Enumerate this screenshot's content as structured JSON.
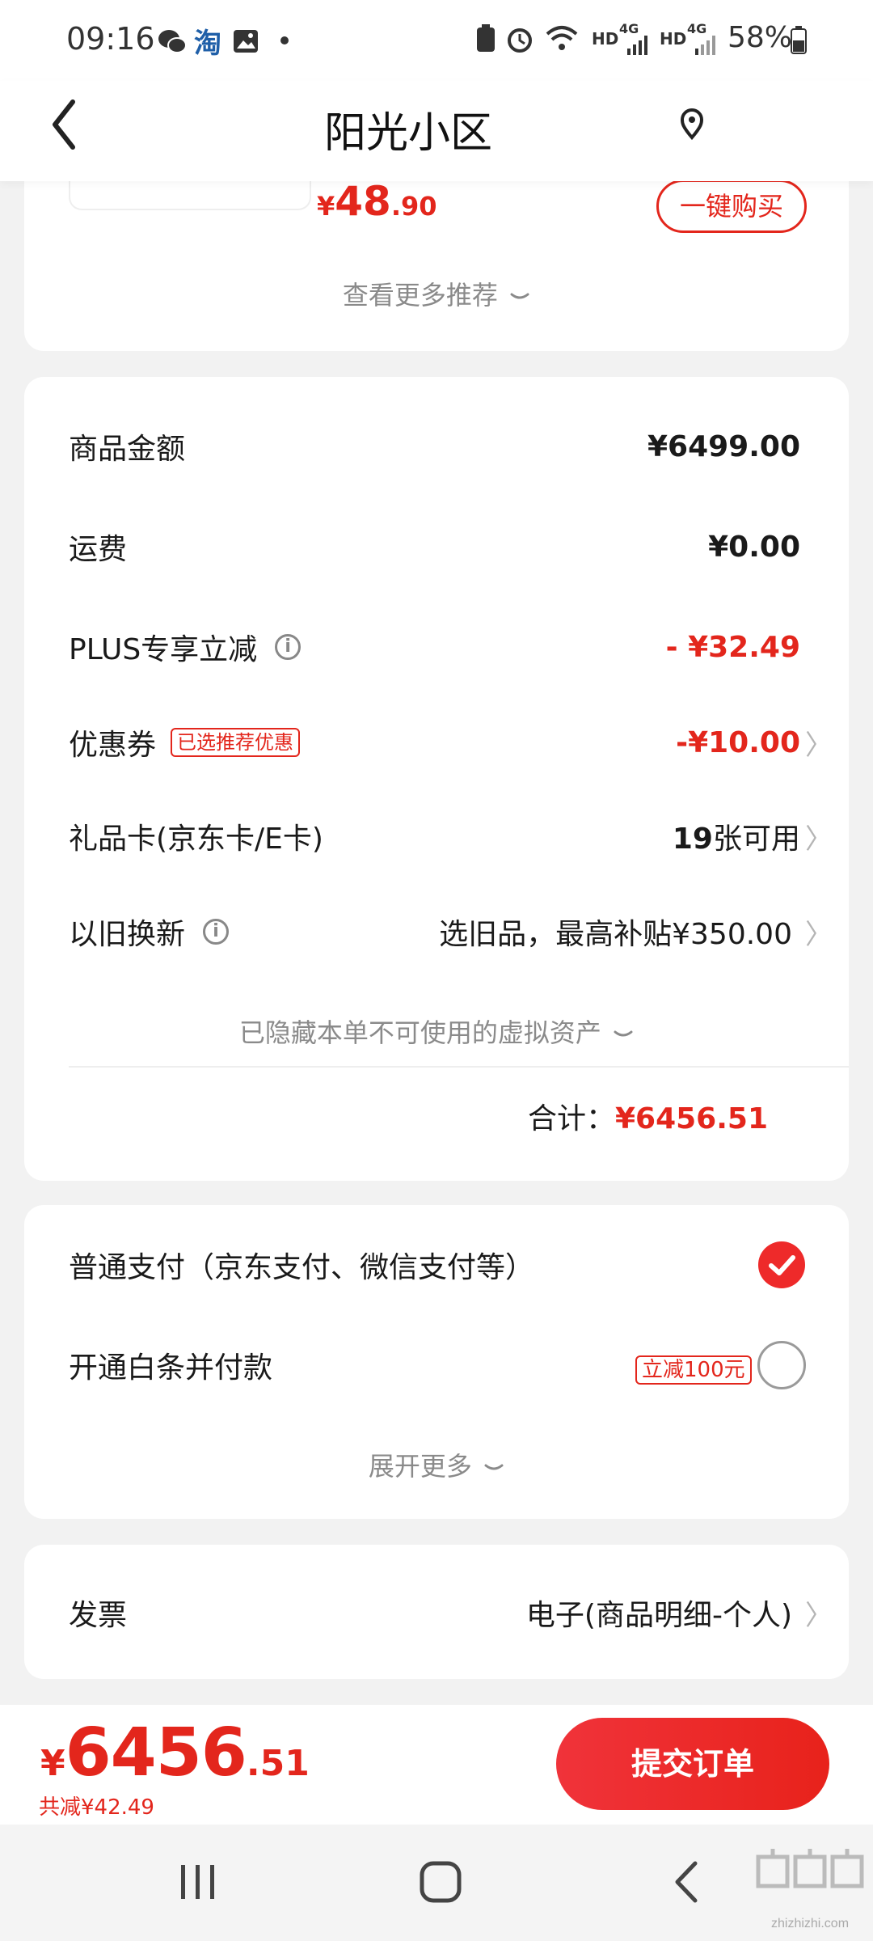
{
  "status": {
    "time": "09:16",
    "taobao_glyph": "淘",
    "network_left": "HD",
    "network_4g_1": "4G",
    "network_right": "HD",
    "network_4g_2": "4G",
    "battery": "58%"
  },
  "header": {
    "title": "阳光小区"
  },
  "recommend": {
    "price_symbol": "¥",
    "price_int": "48",
    "price_dec": ".90",
    "buy_button": "一键购买",
    "see_more": "查看更多推荐"
  },
  "summary": {
    "rows": {
      "goods": {
        "label": "商品金额",
        "value": "¥6499.00"
      },
      "shipping": {
        "label": "运费",
        "value": "¥0.00"
      },
      "plus": {
        "label": "PLUS专享立减",
        "value": "- ¥32.49"
      },
      "coupon": {
        "label": "优惠券",
        "tag": "已选推荐优惠",
        "value": "-¥10.00"
      },
      "giftcard": {
        "label": "礼品卡(京东卡/E卡)",
        "value_num": "19",
        "value_text": "张可用"
      },
      "tradein": {
        "label": "以旧换新",
        "value": "选旧品，最高补贴¥350.00"
      }
    },
    "hidden_assets": "已隐藏本单不可使用的虚拟资产",
    "total_label": "合计：",
    "total_value": "¥6456.51",
    "info_glyph": "i"
  },
  "payment": {
    "normal": "普通支付（京东支付、微信支付等）",
    "baitiao": "开通白条并付款",
    "baitiao_tag": "立减100元",
    "expand": "展开更多"
  },
  "invoice": {
    "label": "发票",
    "value": "电子(商品明细-个人)"
  },
  "bottom": {
    "price_symbol": "¥",
    "price_int": "6456",
    "price_dec": ".51",
    "saving": "共减¥42.49",
    "submit": "提交订单"
  },
  "watermark": {
    "site": "zhizhizhi.com"
  },
  "colors": {
    "accent": "#e3261c",
    "button_gradient": [
      "#f0333a",
      "#e8221b"
    ]
  },
  "icons": [
    "back-arrow-icon",
    "location-pin-icon",
    "wechat-icon",
    "gallery-icon",
    "checkmark-icon",
    "chevron-right-icon",
    "chevron-down-icon",
    "info-icon",
    "recents-icon",
    "home-icon",
    "nav-back-icon"
  ]
}
